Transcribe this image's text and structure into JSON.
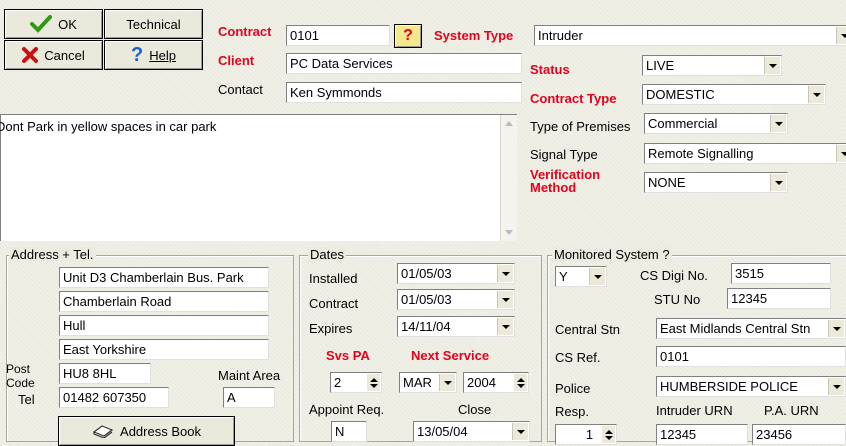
{
  "buttons": {
    "ok": "OK",
    "cancel": "Cancel",
    "technical": "Technical",
    "help": "Help",
    "address_book": "Address Book"
  },
  "contract": {
    "label": "Contract",
    "value": "0101"
  },
  "system_type": {
    "label": "System Type",
    "value": "Intruder"
  },
  "client": {
    "label": "Client",
    "value": "PC Data Services"
  },
  "contact": {
    "label": "Contact",
    "value": "Ken Symmonds"
  },
  "status": {
    "label": "Status",
    "value": "LIVE"
  },
  "contract_type": {
    "label": "Contract Type",
    "value": "DOMESTIC"
  },
  "premises": {
    "label": "Type of Premises",
    "value": "Commercial"
  },
  "signal_type": {
    "label": "Signal Type",
    "value": "Remote Signalling"
  },
  "verification": {
    "label_line1": "Verification",
    "label_line2": "Method",
    "value": "NONE"
  },
  "notes": "Dont Park in yellow spaces in car park",
  "address": {
    "title": "Address + Tel.",
    "line1": "Unit D3 Chamberlain Bus. Park",
    "line2": "Chamberlain Road",
    "line3": "Hull",
    "line4": "East Yorkshire",
    "postcode_label_1": "Post",
    "postcode_label_2": "Code",
    "postcode": "HU8 8HL",
    "maint_area_label": "Maint Area",
    "maint_area": "A",
    "tel_label": "Tel",
    "tel": "01482 607350"
  },
  "dates": {
    "title": "Dates",
    "installed_label": "Installed",
    "installed": "01/05/03",
    "contract_label": "Contract",
    "contract": "01/05/03",
    "expires_label": "Expires",
    "expires": "14/11/04",
    "svs_pa_label": "Svs PA",
    "svs_pa": "2",
    "next_service_label": "Next Service",
    "next_month": "MAR",
    "next_year": "2004",
    "appoint_label": "Appoint Req.",
    "appoint": "N",
    "close_label": "Close",
    "close": "13/05/04"
  },
  "monitored": {
    "title": "Monitored System ?",
    "value": "Y",
    "cs_digi_label": "CS Digi No.",
    "cs_digi": "3515",
    "stu_label": "STU No",
    "stu": "12345",
    "central_stn_label": "Central Stn",
    "central_stn": "East Midlands Central Stn",
    "cs_ref_label": "CS Ref.",
    "cs_ref": "0101",
    "police_label": "Police",
    "police": "HUMBERSIDE POLICE",
    "resp_label": "Resp.",
    "resp": "1",
    "intruder_urn_label": "Intruder URN",
    "intruder_urn": "12345",
    "pa_urn_label": "P.A. URN",
    "pa_urn": "23456"
  },
  "colors": {
    "label_red": "#e8001c",
    "check_green": "#2e9a12",
    "cancel_red": "#c81010",
    "help_blue": "#1a5fd0"
  }
}
